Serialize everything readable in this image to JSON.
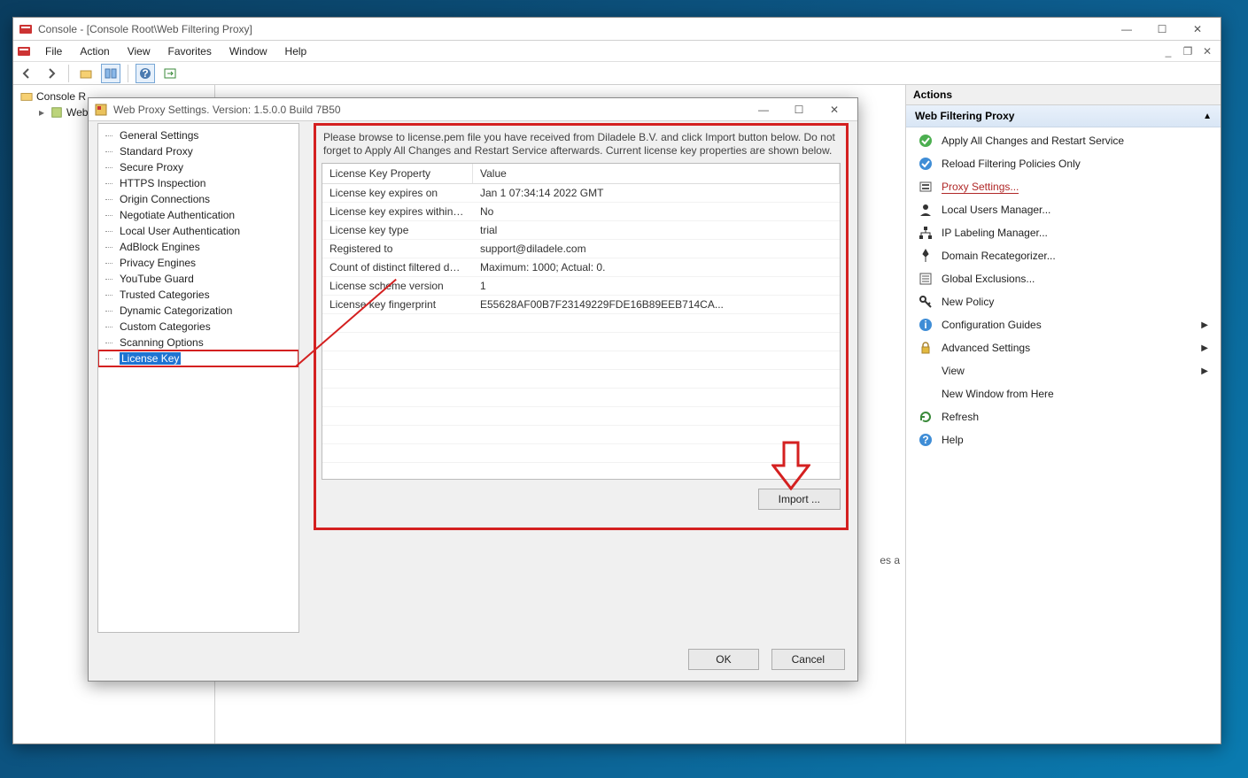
{
  "main_window": {
    "title": "Console - [Console Root\\Web Filtering Proxy]",
    "menus": [
      "File",
      "Action",
      "View",
      "Favorites",
      "Window",
      "Help"
    ],
    "tree": {
      "root": "Console R",
      "child": "Web F"
    }
  },
  "actions": {
    "header": "Actions",
    "group": "Web Filtering Proxy",
    "items": [
      {
        "icon": "check-green",
        "label": "Apply All Changes and Restart Service",
        "chev": false
      },
      {
        "icon": "check-blue",
        "label": "Reload Filtering Policies Only",
        "chev": false
      },
      {
        "icon": "settings",
        "label": "Proxy Settings...",
        "chev": false,
        "hl": true
      },
      {
        "icon": "user",
        "label": "Local Users Manager...",
        "chev": false
      },
      {
        "icon": "hierarchy",
        "label": "IP Labeling Manager...",
        "chev": false
      },
      {
        "icon": "pin",
        "label": "Domain Recategorizer...",
        "chev": false
      },
      {
        "icon": "list",
        "label": "Global Exclusions...",
        "chev": false
      },
      {
        "icon": "key",
        "label": "New Policy",
        "chev": false
      },
      {
        "icon": "info",
        "label": "Configuration Guides",
        "chev": true
      },
      {
        "icon": "lock",
        "label": "Advanced Settings",
        "chev": true
      },
      {
        "icon": "",
        "label": "View",
        "chev": true
      },
      {
        "icon": "",
        "label": "New Window from Here",
        "chev": false
      },
      {
        "icon": "refresh",
        "label": "Refresh",
        "chev": false
      },
      {
        "icon": "help",
        "label": "Help",
        "chev": false
      }
    ]
  },
  "dialog": {
    "title": "Web Proxy Settings. Version: 1.5.0.0 Build 7B50",
    "tree": [
      "General Settings",
      "Standard Proxy",
      "Secure Proxy",
      "HTTPS Inspection",
      "Origin Connections",
      "Negotiate Authentication",
      "Local User Authentication",
      "AdBlock Engines",
      "Privacy Engines",
      "YouTube Guard",
      "Trusted Categories",
      "Dynamic Categorization",
      "Custom Categories",
      "Scanning Options",
      "License Key"
    ],
    "selected": "License Key",
    "hint": "Please browse to license.pem file you have received from Diladele B.V. and click Import button below. Do not forget to Apply All Changes and Restart Service afterwards. Current license key properties are shown below.",
    "columns": [
      "License Key Property",
      "Value"
    ],
    "rows": [
      {
        "k": "License key expires on",
        "v": "Jan  1 07:34:14 2022 GMT"
      },
      {
        "k": "License key expires within tw...",
        "v": "No"
      },
      {
        "k": "License key type",
        "v": "trial"
      },
      {
        "k": "Registered to",
        "v": "support@diladele.com"
      },
      {
        "k": "Count of distinct filtered devi...",
        "v": "Maximum: 1000; Actual: 0."
      },
      {
        "k": "License scheme version",
        "v": "1"
      },
      {
        "k": "License key fingerprint",
        "v": "E55628AF00B7F23149229FDE16B89EEB714CA..."
      }
    ],
    "import_label": "Import ...",
    "ok": "OK",
    "cancel": "Cancel"
  },
  "center_peek": "es a"
}
